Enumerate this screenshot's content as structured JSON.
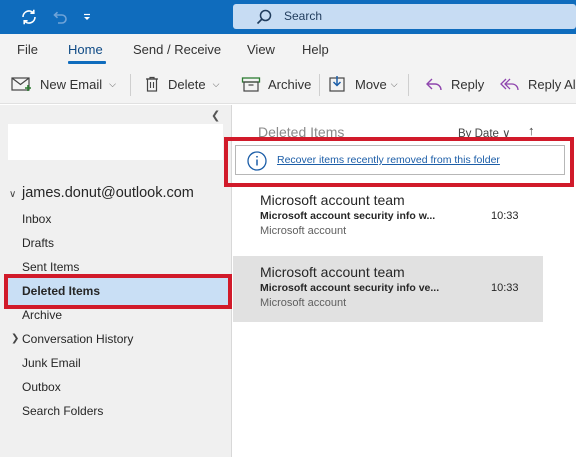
{
  "titlebar": {
    "search_placeholder": "Search"
  },
  "menu": {
    "tabs": [
      "File",
      "Home",
      "Send / Receive",
      "View",
      "Help"
    ],
    "active_tab": "Home"
  },
  "toolbar": {
    "new_email": "New Email",
    "delete": "Delete",
    "archive": "Archive",
    "move": "Move",
    "reply": "Reply",
    "reply_all": "Reply Al"
  },
  "folders": {
    "account": "james.donut@outlook.com",
    "items": [
      "Inbox",
      "Drafts",
      "Sent Items",
      "Deleted Items",
      "Archive",
      "Conversation History",
      "Junk Email",
      "Outbox",
      "Search Folders"
    ],
    "selected": "Deleted Items"
  },
  "list": {
    "title": "Deleted Items",
    "sort_label": "By Date",
    "recover_link": "Recover items recently removed from this folder",
    "messages": [
      {
        "sender": "Microsoft account team",
        "subject": "Microsoft account security info w...",
        "time": "10:33",
        "preview": "Microsoft account",
        "selected": false
      },
      {
        "sender": "Microsoft account team",
        "subject": "Microsoft account security info ve...",
        "time": "10:33",
        "preview": "Microsoft account",
        "selected": true
      }
    ]
  },
  "colors": {
    "accent": "#0f6cbd",
    "highlight": "#d11a2a",
    "selection": "#c9dff5"
  },
  "icons": [
    "sync-icon",
    "undo-icon",
    "qat-dropdown-icon",
    "search-icon",
    "new-email-icon",
    "delete-icon",
    "archive-icon",
    "move-icon",
    "reply-icon",
    "reply-all-icon",
    "info-icon"
  ]
}
